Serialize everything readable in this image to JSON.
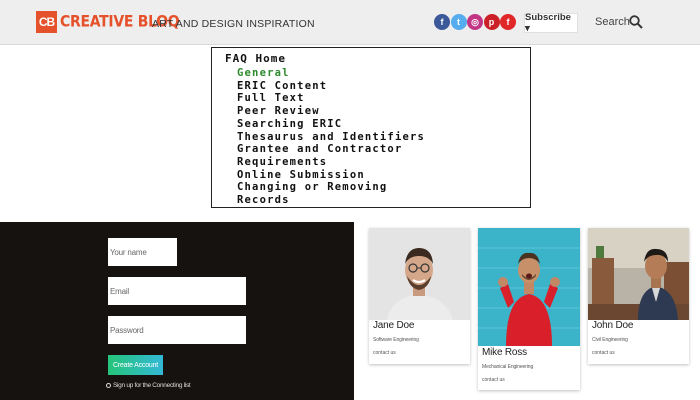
{
  "header": {
    "logo_badge": "CB",
    "logo_word": "CREATIVE BLOQ",
    "tagline": "ART AND DESIGN INSPIRATION",
    "social": [
      {
        "icon": "facebook-icon",
        "glyph": "f",
        "color": "#3b5998"
      },
      {
        "icon": "twitter-icon",
        "glyph": "t",
        "color": "#55acee"
      },
      {
        "icon": "instagram-icon",
        "glyph": "◎",
        "color": "#c13584"
      },
      {
        "icon": "pinterest-icon",
        "glyph": "p",
        "color": "#cb2027"
      },
      {
        "icon": "flipboard-icon",
        "glyph": "f",
        "color": "#e12828"
      }
    ],
    "subscribe_label": "Subscribe ▾",
    "search_label": "Search"
  },
  "faq": {
    "title": "FAQ Home",
    "items": [
      "General",
      "ERIC Content",
      "Full Text",
      "Peer Review",
      "Searching ERIC",
      "Thesaurus and Identifiers",
      "Grantee and Contractor",
      "Requirements",
      "Online Submission",
      "Changing or Removing",
      "Records"
    ],
    "active_index": 0,
    "active_color": "#2d8a2d"
  },
  "login": {
    "name_placeholder": "Your name",
    "email_placeholder": "Email",
    "password_placeholder": "Password",
    "button_label": "Create Account",
    "signup_text": "Sign up for the Connecting list"
  },
  "cards": [
    {
      "name": "Jane Doe",
      "role": "Software Engineering",
      "email": "contact us"
    },
    {
      "name": "Mike Ross",
      "role": "Mechanical Engineering",
      "email": "contact us"
    },
    {
      "name": "John Doe",
      "role": "Civil Engineering",
      "email": "contact us"
    }
  ]
}
